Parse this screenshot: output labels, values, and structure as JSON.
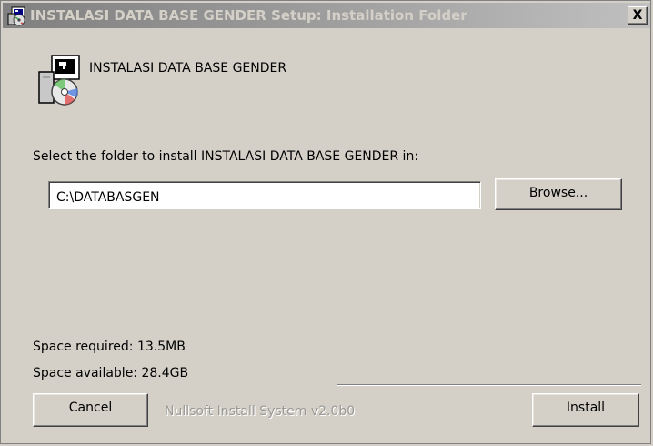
{
  "window": {
    "title": "INSTALASI DATA BASE GENDER Setup: Installation Folder",
    "close_glyph": "X",
    "title_icon": "installer-icon"
  },
  "header": {
    "title": "INSTALASI DATA BASE GENDER",
    "icon": "installer-cd-icon"
  },
  "folder": {
    "label": "Select the folder to install INSTALASI DATA BASE GENDER in:",
    "path": "C:\\DATABASGEN",
    "browse_label": "Browse..."
  },
  "space": {
    "required": "Space required: 13.5MB",
    "available": "Space available: 28.4GB"
  },
  "footer": {
    "cancel_label": "Cancel",
    "branding": "Nullsoft Install System v2.0b0",
    "install_label": "Install"
  },
  "colors": {
    "face": "#d4d0c8",
    "titlebar_inactive_start": "#808080",
    "titlebar_inactive_end": "#c0c0c0",
    "branding_text": "#9a9894"
  }
}
